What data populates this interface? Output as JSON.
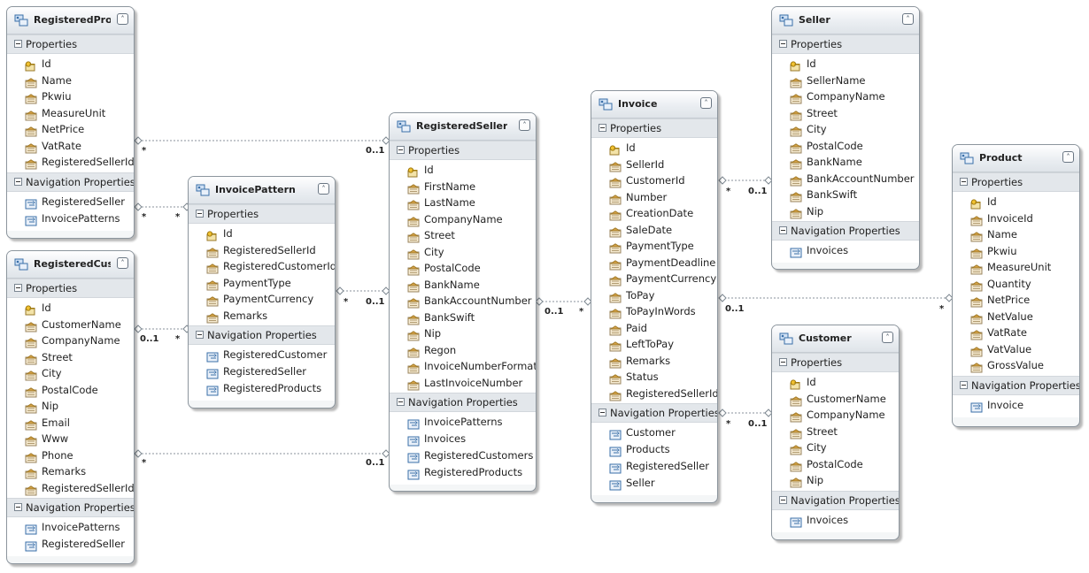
{
  "colors": {
    "connector": "#8a929b",
    "header": "#e9edf1",
    "key_icon": "#e0b020",
    "prop_icon": "#c78a2a",
    "nav_icon": "#3a6fa8"
  },
  "icons": {
    "entity": "entity-icon",
    "key": "key-icon",
    "property": "property-icon",
    "navigation": "navigation-property-icon",
    "collapse": "collapse-icon"
  },
  "section_labels": {
    "properties": "Properties",
    "navigation": "Navigation Properties"
  },
  "entities": {
    "registered_products": {
      "title": "RegisteredPro...",
      "properties": [
        "Id",
        "Name",
        "Pkwiu",
        "MeasureUnit",
        "NetPrice",
        "VatRate",
        "RegisteredSellerId"
      ],
      "navigation": [
        "RegisteredSeller",
        "InvoicePatterns"
      ]
    },
    "registered_customer": {
      "title": "RegisteredCus...",
      "properties": [
        "Id",
        "CustomerName",
        "CompanyName",
        "Street",
        "City",
        "PostalCode",
        "Nip",
        "Email",
        "Www",
        "Phone",
        "Remarks",
        "RegisteredSellerId"
      ],
      "navigation": [
        "InvoicePatterns",
        "RegisteredSeller"
      ]
    },
    "invoice_pattern": {
      "title": "InvoicePattern",
      "properties": [
        "Id",
        "RegisteredSellerId",
        "RegisteredCustomerId",
        "PaymentType",
        "PaymentCurrency",
        "Remarks"
      ],
      "navigation": [
        "RegisteredCustomer",
        "RegisteredSeller",
        "RegisteredProducts"
      ]
    },
    "registered_seller": {
      "title": "RegisteredSeller",
      "properties": [
        "Id",
        "FirstName",
        "LastName",
        "CompanyName",
        "Street",
        "City",
        "PostalCode",
        "BankName",
        "BankAccountNumber",
        "BankSwift",
        "Nip",
        "Regon",
        "InvoiceNumberFormat",
        "LastInvoiceNumber"
      ],
      "navigation": [
        "InvoicePatterns",
        "Invoices",
        "RegisteredCustomers",
        "RegisteredProducts"
      ]
    },
    "invoice": {
      "title": "Invoice",
      "properties": [
        "Id",
        "SellerId",
        "CustomerId",
        "Number",
        "CreationDate",
        "SaleDate",
        "PaymentType",
        "PaymentDeadline",
        "PaymentCurrency",
        "ToPay",
        "ToPayInWords",
        "Paid",
        "LeftToPay",
        "Remarks",
        "Status",
        "RegisteredSellerId"
      ],
      "navigation": [
        "Customer",
        "Products",
        "RegisteredSeller",
        "Seller"
      ]
    },
    "seller": {
      "title": "Seller",
      "properties": [
        "Id",
        "SellerName",
        "CompanyName",
        "Street",
        "City",
        "PostalCode",
        "BankName",
        "BankAccountNumber",
        "BankSwift",
        "Nip"
      ],
      "navigation": [
        "Invoices"
      ]
    },
    "customer": {
      "title": "Customer",
      "properties": [
        "Id",
        "CustomerName",
        "CompanyName",
        "Street",
        "City",
        "PostalCode",
        "Nip"
      ],
      "navigation": [
        "Invoices"
      ]
    },
    "product": {
      "title": "Product",
      "properties": [
        "Id",
        "InvoiceId",
        "Name",
        "Pkwiu",
        "MeasureUnit",
        "Quantity",
        "NetPrice",
        "NetValue",
        "VatRate",
        "VatValue",
        "GrossValue"
      ],
      "navigation": [
        "Invoice"
      ]
    }
  },
  "multiplicity": {
    "products_seller_left": "*",
    "products_seller_right": "0..1",
    "products_pattern_left": "*",
    "products_pattern_right": "*",
    "customer_pattern_left": "0..1",
    "customer_pattern_right": "*",
    "pattern_seller_left": "*",
    "pattern_seller_right": "0..1",
    "customer_seller_left": "*",
    "customer_seller_right": "0..1",
    "seller_invoice_left": "0..1",
    "seller_invoice_right": "*",
    "invoice_seller_left": "*",
    "invoice_seller_right": "0..1",
    "invoice_product_left": "0..1",
    "invoice_product_right": "*",
    "invoice_customer_left": "*",
    "invoice_customer_right": "0..1"
  }
}
